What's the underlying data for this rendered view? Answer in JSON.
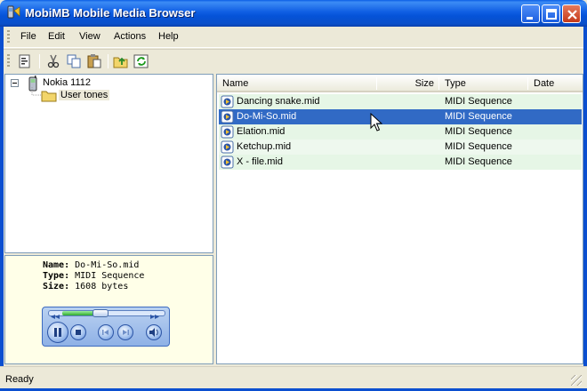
{
  "window": {
    "title": "MobiMB Mobile Media Browser"
  },
  "menu": {
    "items": [
      "File",
      "Edit",
      "View",
      "Actions",
      "Help"
    ]
  },
  "tree": {
    "device": "Nokia 1112",
    "folder": "User tones"
  },
  "columns": {
    "name": "Name",
    "size": "Size",
    "type": "Type",
    "date": "Date"
  },
  "files": [
    {
      "name": "Dancing snake.mid",
      "type": "MIDI Sequence"
    },
    {
      "name": "Do-Mi-So.mid",
      "type": "MIDI Sequence"
    },
    {
      "name": "Elation.mid",
      "type": "MIDI Sequence"
    },
    {
      "name": "Ketchup.mid",
      "type": "MIDI Sequence"
    },
    {
      "name": "X - file.mid",
      "type": "MIDI Sequence"
    }
  ],
  "info": {
    "name_label": "Name:",
    "name_value": "Do-Mi-So.mid",
    "type_label": "Type:",
    "type_value": "MIDI Sequence",
    "size_label": "Size:",
    "size_value": "1608 bytes"
  },
  "player": {
    "progress": 0.45
  },
  "status": {
    "text": "Ready"
  },
  "colors": {
    "selection": "#316ac5",
    "alt_row": "#e6f6e6",
    "info_bg": "#ffffe8"
  }
}
